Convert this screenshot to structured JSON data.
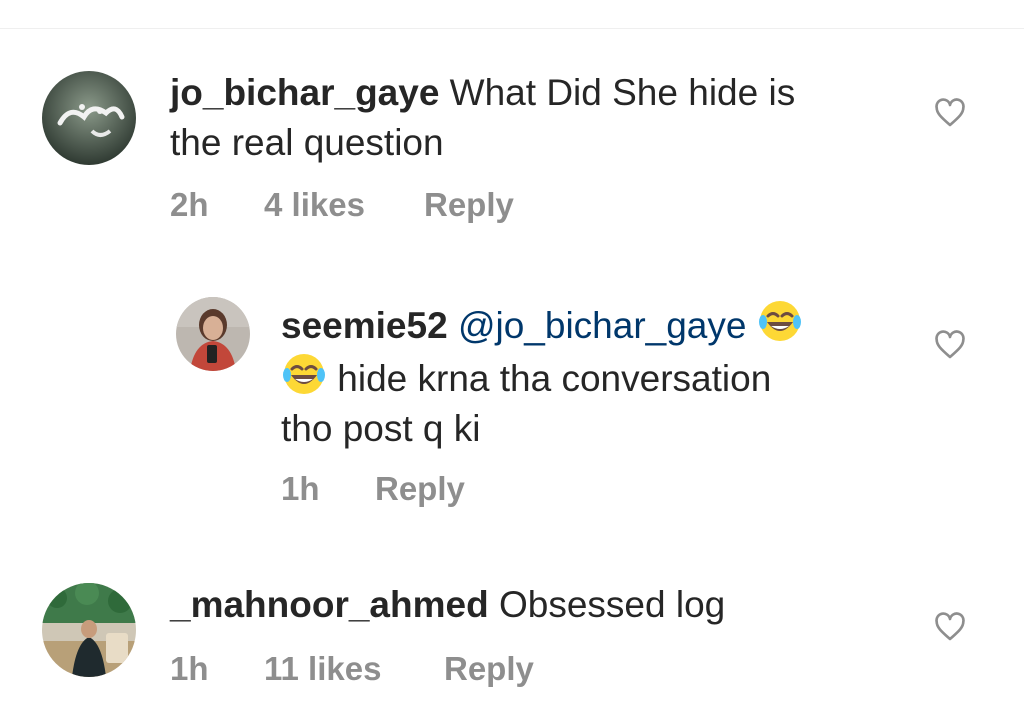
{
  "comments": [
    {
      "username": "jo_bichar_gaye",
      "text_line1": " What Did She hide is",
      "text_line2": "the real question",
      "time": "2h",
      "likes": "4 likes",
      "reply": "Reply"
    },
    {
      "username": "seemie52",
      "mention": "@jo_bichar_gaye",
      "text_line2": " hide krna tha conversation",
      "text_line3": "tho post q ki",
      "time": "1h",
      "reply": "Reply"
    },
    {
      "username": "_mahnoor_ahmed",
      "text_line1": " Obsessed log",
      "time": "1h",
      "likes": "11 likes",
      "reply": "Reply"
    }
  ],
  "colors": {
    "username": "#262626",
    "mention": "#00376b",
    "meta": "#8e8e8e",
    "heart": "#8e8e8e"
  },
  "icons": [
    "heart-outline-icon",
    "face-with-tears-of-joy-emoji"
  ]
}
